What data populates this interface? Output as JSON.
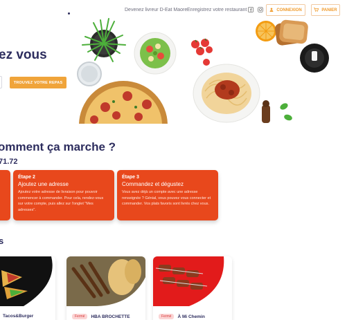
{
  "nav": {
    "links": [
      "Devenez livreur D-Eat Maore",
      "Enregistrez votre restaurant"
    ],
    "social_icons": [
      "facebook-icon",
      "instagram-icon"
    ],
    "login_label": "CONNEXION",
    "cart_label": "PANIER"
  },
  "hero": {
    "title": "ez vous",
    "cta_label": "TROUVEZ VOTRE REPAS"
  },
  "how": {
    "title": "omment ça marche ?",
    "number": "71.72",
    "steps": [
      {
        "number": "Étape 2",
        "heading": "Ajoutez une adresse",
        "body": "Ajoutez votre adresse de livraison pour pouvoir commencer à commander. Pour cela, rendez-vous sur votre compte, puis allez sur l'onglet \"Mes adresses\"."
      },
      {
        "number": "Étape 3",
        "heading": "Commandez et dégustez",
        "body": "Vous avez déjà un compte avec une adresse renseignée ? Génial, vous pouvez vous connecter et commander. Vos plats favoris sont livrés chez vous."
      }
    ]
  },
  "restaurants": {
    "section_letter": "s",
    "items": [
      {
        "name": "Tacos&Burger",
        "status": ""
      },
      {
        "name": "HBA BROCHETTE",
        "status": "Fermé"
      },
      {
        "name": "À Mi Chemin",
        "status": "Fermé"
      }
    ]
  },
  "colors": {
    "accent": "#f0a43a",
    "step_card": "#e8481c",
    "heading": "#2d2d5e",
    "closed_badge": "#fbd4d4"
  }
}
